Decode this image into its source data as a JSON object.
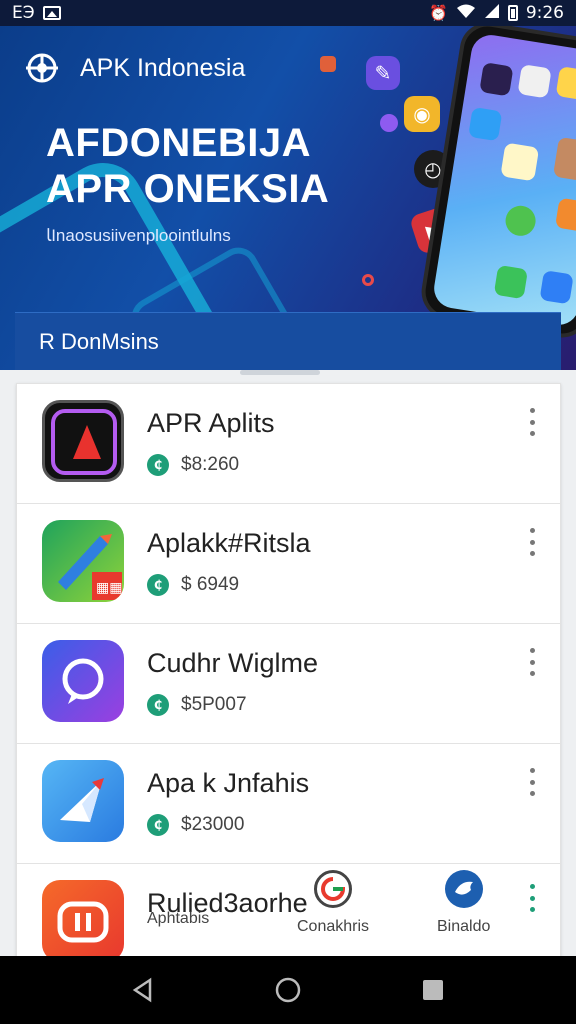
{
  "status_bar": {
    "left_text": "ЕЭ",
    "time": "9:26"
  },
  "banner": {
    "brand_name": "APK Indonesia",
    "title_line1": "AFDONEBIJA",
    "title_line2": "APR ONEKSIA",
    "subtitle": "ﺎΙnaosusiivenploointlulns",
    "section_title": "R DonMsins"
  },
  "apps": [
    {
      "name": "APR Aplits",
      "price": "$8:260"
    },
    {
      "name": "Aplakk#Ritsla",
      "price": "$ 6949"
    },
    {
      "name": "Cudhr Wiglme",
      "price": "$5P007"
    },
    {
      "name": "Apa k Jnfahis",
      "price": "$23000"
    },
    {
      "name": "Rulied3aorhe",
      "price": ""
    }
  ],
  "bottom_tabs": [
    {
      "label": "Aphtabis",
      "icon": "apps-icon"
    },
    {
      "label": "Conakhris",
      "icon": "g-icon"
    },
    {
      "label": "Binaldo",
      "icon": "bird-icon"
    }
  ],
  "colors": {
    "accent": "#1e9e78",
    "banner": "#124fa8"
  }
}
